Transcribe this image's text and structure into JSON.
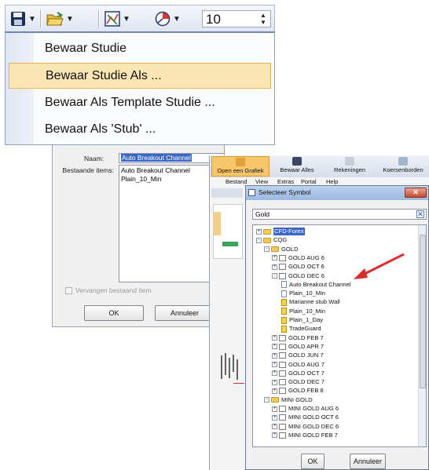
{
  "toolbar": {
    "save_icon": "floppy-disk-icon",
    "open_icon": "open-folder-icon",
    "chart_icon": "chart-icon",
    "clock_icon": "clock-icon",
    "spin_value": "10"
  },
  "menu": {
    "items": [
      {
        "label": "Bewaar Studie"
      },
      {
        "label": "Bewaar Studie Als ..."
      },
      {
        "label": "Bewaar Als Template Studie ..."
      },
      {
        "label": "Bewaar Als 'Stub' ..."
      }
    ],
    "selected_index": 1
  },
  "save_dialog": {
    "name_label": "Naam:",
    "name_value": "Auto Breakout Channel",
    "items_label": "Bestaande items:",
    "items": [
      "Auto Breakout Channel",
      "Plain_10_Min"
    ],
    "replace_label": "Vervangen bestaand item",
    "ok": "OK",
    "cancel": "Annuleer"
  },
  "app": {
    "buttons": [
      "Open een Grafiek",
      "Bewaar Alles",
      "Rekeningen",
      "Koersenborden"
    ],
    "menu": [
      "Bestand",
      "View",
      "Extras",
      "Portal",
      "Help"
    ]
  },
  "symbol_dialog": {
    "title": "Selecteer Symbol",
    "search_value": "Gold",
    "ok": "OK",
    "cancel": "Annuleer",
    "tree": [
      {
        "label": "CFD-Forex",
        "level": 0,
        "type": "folder",
        "toggle": "+",
        "highlight": true
      },
      {
        "label": "CQG",
        "level": 0,
        "type": "folder",
        "toggle": "-"
      },
      {
        "label": "GOLD",
        "level": 1,
        "type": "folder",
        "toggle": "-"
      },
      {
        "label": "GOLD AUG 6",
        "level": 2,
        "type": "symbol",
        "toggle": "+"
      },
      {
        "label": "GOLD OCT 6",
        "level": 2,
        "type": "symbol",
        "toggle": "+"
      },
      {
        "label": "GOLD DEC 6",
        "level": 2,
        "type": "symbol",
        "toggle": "-"
      },
      {
        "label": "Auto Breakout Channel",
        "level": 3,
        "type": "doc"
      },
      {
        "label": "Plain_10_Min",
        "level": 3,
        "type": "doc"
      },
      {
        "label": "Marianne stub Wall",
        "level": 3,
        "type": "docy"
      },
      {
        "label": "Plain_10_Min",
        "level": 3,
        "type": "docy"
      },
      {
        "label": "Plain_1_Day",
        "level": 3,
        "type": "docy"
      },
      {
        "label": "TradeGuard",
        "level": 3,
        "type": "docy"
      },
      {
        "label": "GOLD FEB 7",
        "level": 2,
        "type": "symbol",
        "toggle": "+"
      },
      {
        "label": "GOLD APR 7",
        "level": 2,
        "type": "symbol",
        "toggle": "+"
      },
      {
        "label": "GOLD JUN 7",
        "level": 2,
        "type": "symbol",
        "toggle": "+"
      },
      {
        "label": "GOLD AUG 7",
        "level": 2,
        "type": "symbol",
        "toggle": "+"
      },
      {
        "label": "GOLD OCT 7",
        "level": 2,
        "type": "symbol",
        "toggle": "+"
      },
      {
        "label": "GOLD DEC 7",
        "level": 2,
        "type": "symbol",
        "toggle": "+"
      },
      {
        "label": "GOLD FEB 8",
        "level": 2,
        "type": "symbol",
        "toggle": "+"
      },
      {
        "label": "MINI GOLD",
        "level": 1,
        "type": "folder",
        "toggle": "-"
      },
      {
        "label": "MINI GOLD AUG 6",
        "level": 2,
        "type": "symbol",
        "toggle": "+"
      },
      {
        "label": "MINI GOLD OCT 6",
        "level": 2,
        "type": "symbol",
        "toggle": "+"
      },
      {
        "label": "MINI GOLD DEC 6",
        "level": 2,
        "type": "symbol",
        "toggle": "+"
      },
      {
        "label": "MINI GOLD FEB 7",
        "level": 2,
        "type": "symbol",
        "toggle": "+"
      }
    ]
  },
  "colors": {
    "highlight": "#3b68c7",
    "arrow": "#e02a2a",
    "menu_selected": "#fbe5b3"
  }
}
